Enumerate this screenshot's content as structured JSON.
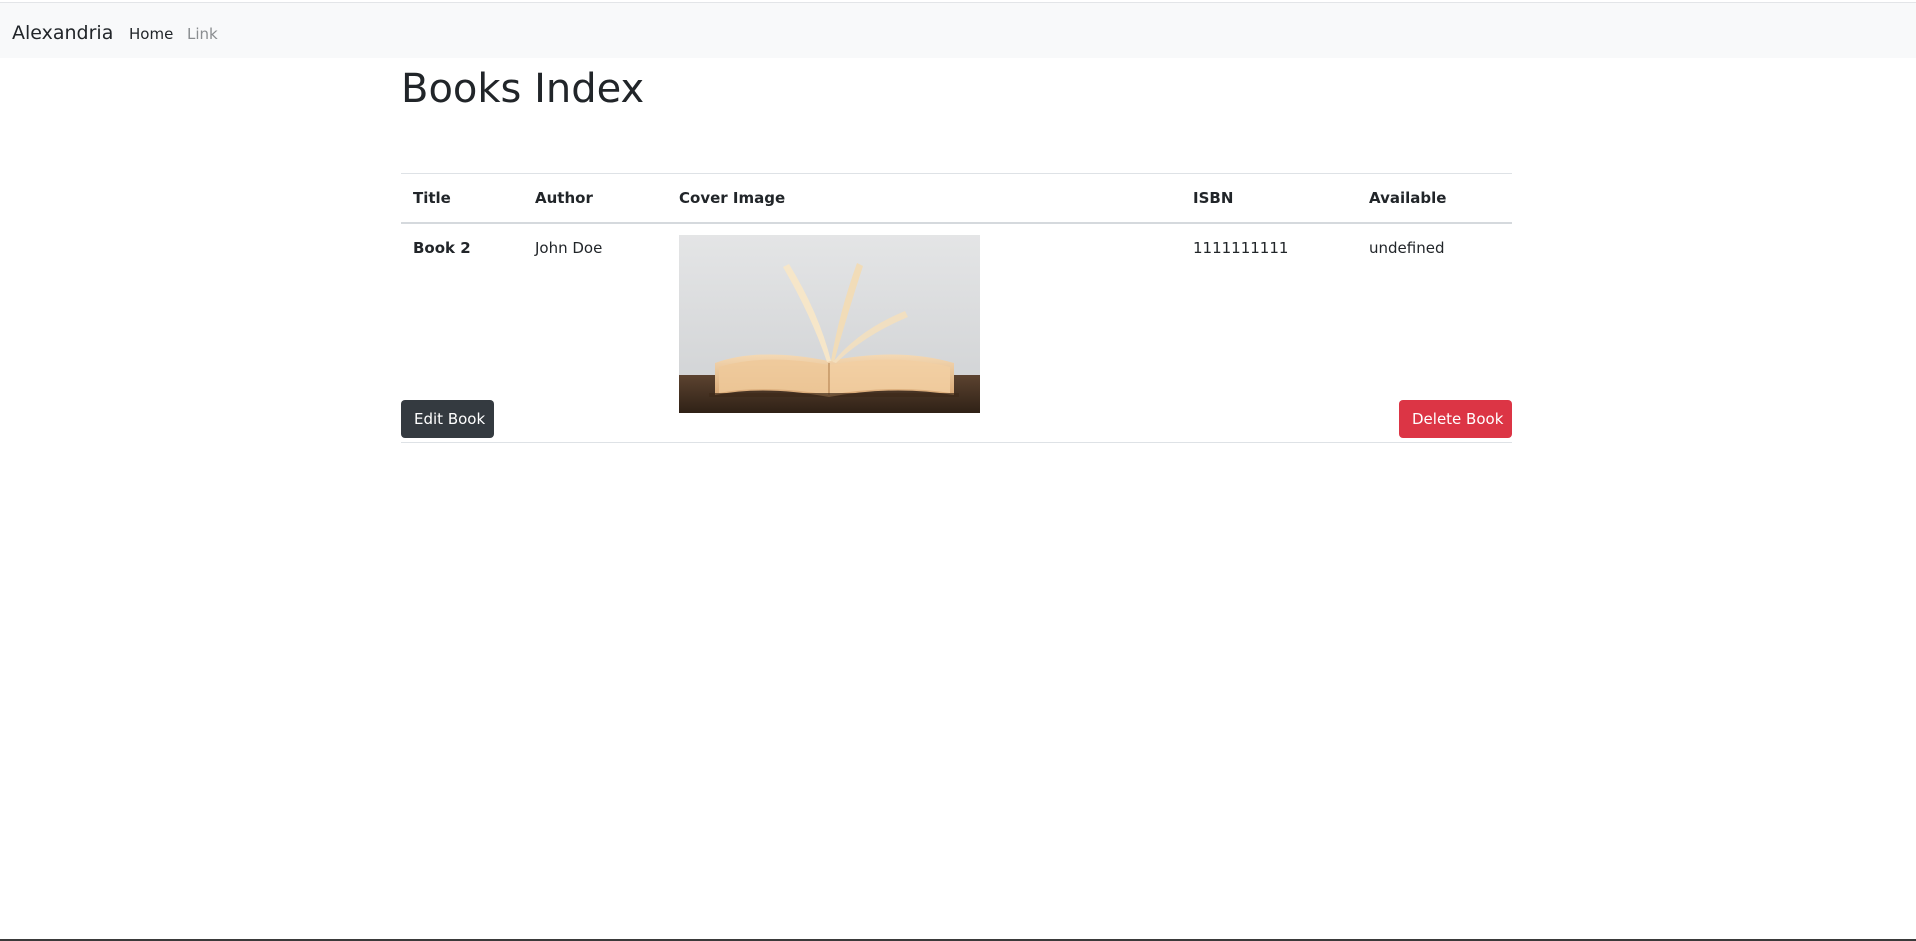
{
  "navbar": {
    "brand": "Alexandria",
    "links": [
      {
        "label": "Home"
      },
      {
        "label": "Link"
      }
    ]
  },
  "page": {
    "title": "Books Index"
  },
  "table": {
    "headers": [
      "Title",
      "Author",
      "Cover Image",
      "ISBN",
      "Available"
    ],
    "rows": [
      {
        "title": "Book 2",
        "author": "John Doe",
        "cover_image": "open-book-photo",
        "isbn": "1111111111",
        "available": "undefined"
      }
    ]
  },
  "actions": {
    "edit_label": "Edit Book",
    "delete_label": "Delete Book"
  },
  "colors": {
    "navbar_bg": "#f8f9fa",
    "edit_button": "#343a40",
    "delete_button": "#dc3545",
    "text": "#212529",
    "muted_link": "#8a8d90"
  }
}
